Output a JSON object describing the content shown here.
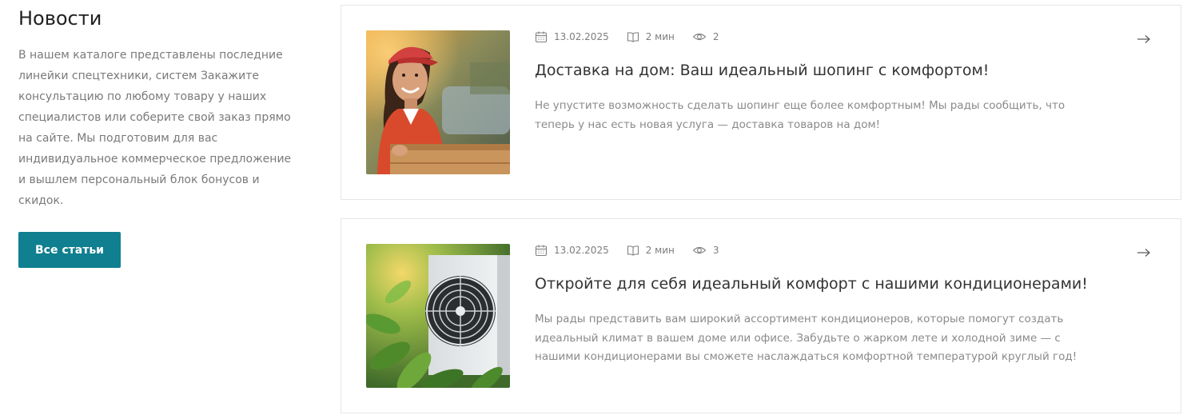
{
  "intro": {
    "title": "Новости",
    "text": "В нашем каталоге представлены последние линейки спецтехники, систем Закажите консультацию по любому товару у наших специалистов или соберите свой заказ прямо на сайте. Мы подготовим для вас индивидуальное коммерческое предложение и вышлем персональный блок бонусов и скидок.",
    "button_label": "Все статьи"
  },
  "colors": {
    "accent": "#107f8f",
    "muted_text": "#8a8a8a",
    "card_border": "#e6e6e6"
  },
  "news": [
    {
      "date": "13.02.2025",
      "read_time": "2 мин",
      "views": "2",
      "title": "Доставка на дом: Ваш идеальный шопинг с комфортом!",
      "text": "Не упустите возможность сделать шопинг еще более комфортным! Мы рады сообщить, что теперь у нас есть новая услуга — доставка товаров на дом!",
      "image": "delivery-courier-photo"
    },
    {
      "date": "13.02.2025",
      "read_time": "2 мин",
      "views": "3",
      "title": "Откройте для себя идеальный комфорт с нашими кондиционерами!",
      "text": "Мы рады представить вам широкий ассортимент кондиционеров, которые помогут создать идеальный климат в вашем доме или офисе. Забудьте о жарком лете и холодной зиме — с нашими кондиционерами вы сможете наслаждаться комфортной температурой круглый год!",
      "image": "air-conditioner-photo"
    }
  ]
}
